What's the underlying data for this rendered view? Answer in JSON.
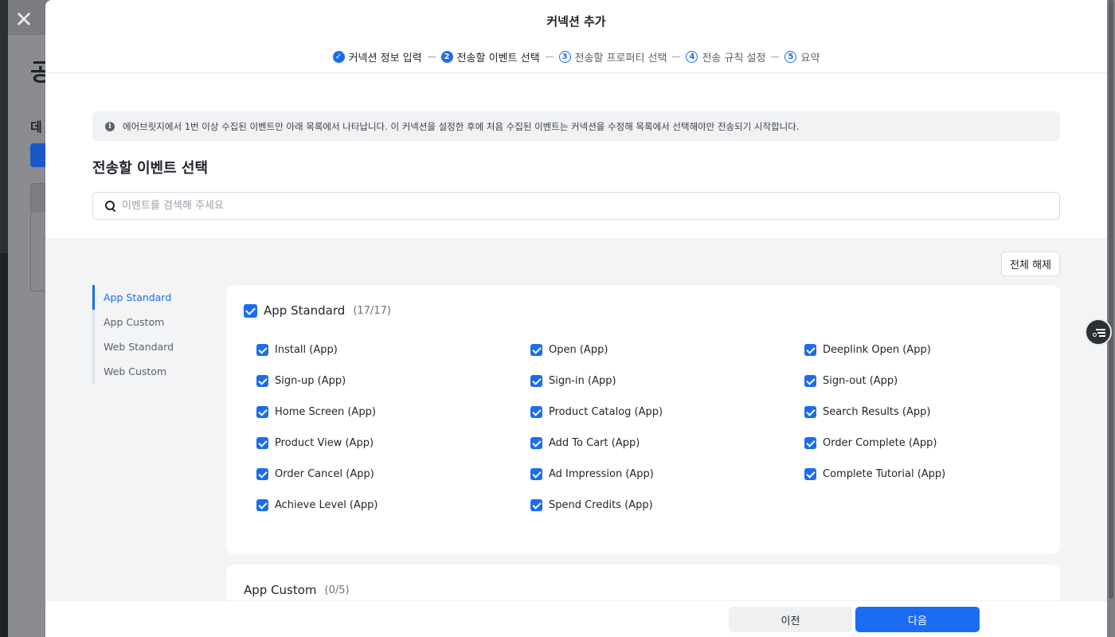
{
  "modal": {
    "title": "커넥션 추가",
    "close_icon": "close-icon"
  },
  "stepper": [
    {
      "num": "✓",
      "label": "커넥션 정보 입력",
      "state": "done"
    },
    {
      "num": "2",
      "label": "전송할 이벤트 선택",
      "state": "active"
    },
    {
      "num": "3",
      "label": "전송할 프로퍼티 선택",
      "state": "todo"
    },
    {
      "num": "4",
      "label": "전송 규칙 설정",
      "state": "todo"
    },
    {
      "num": "5",
      "label": "요약",
      "state": "todo"
    }
  ],
  "notice": {
    "icon": "info-icon",
    "text": "에어브릿지에서 1번 이상 수집된 이벤트만 아래 목록에서 나타납니다. 이 커넥션을 설정한 후에 처음 수집된 이벤트는 커넥션을 수정해 목록에서 선택해야만 전송되기 시작합니다."
  },
  "section": {
    "title": "전송할 이벤트 선택"
  },
  "search": {
    "placeholder": "이벤트를 검색해 주세요",
    "value": ""
  },
  "toolbar": {
    "clear_all_label": "전체 해제"
  },
  "categories": [
    {
      "label": "App Standard",
      "active": true
    },
    {
      "label": "App Custom",
      "active": false
    },
    {
      "label": "Web Standard",
      "active": false
    },
    {
      "label": "Web Custom",
      "active": false
    }
  ],
  "groups": [
    {
      "title": "App Standard",
      "count": "(17/17)",
      "checked": true,
      "events": [
        "Install (App)",
        "Open (App)",
        "Deeplink Open (App)",
        "Sign-up (App)",
        "Sign-in (App)",
        "Sign-out (App)",
        "Home Screen (App)",
        "Product Catalog (App)",
        "Search Results (App)",
        "Product View (App)",
        "Add To Cart (App)",
        "Order Complete (App)",
        "Order Cancel (App)",
        "Ad Impression (App)",
        "Complete Tutorial (App)",
        "Achieve Level (App)",
        "Spend Credits (App)"
      ]
    },
    {
      "title": "App Custom",
      "count": "(0/5)"
    }
  ],
  "footer": {
    "prev_label": "이전",
    "next_label": "다음"
  },
  "backdrop": {
    "heading_fragment": "공",
    "subheading_fragment": "데"
  },
  "colors": {
    "accent": "#1b6cf2",
    "notice_bg": "#f1f2f4",
    "panel_bg": "#f3f4f6"
  }
}
